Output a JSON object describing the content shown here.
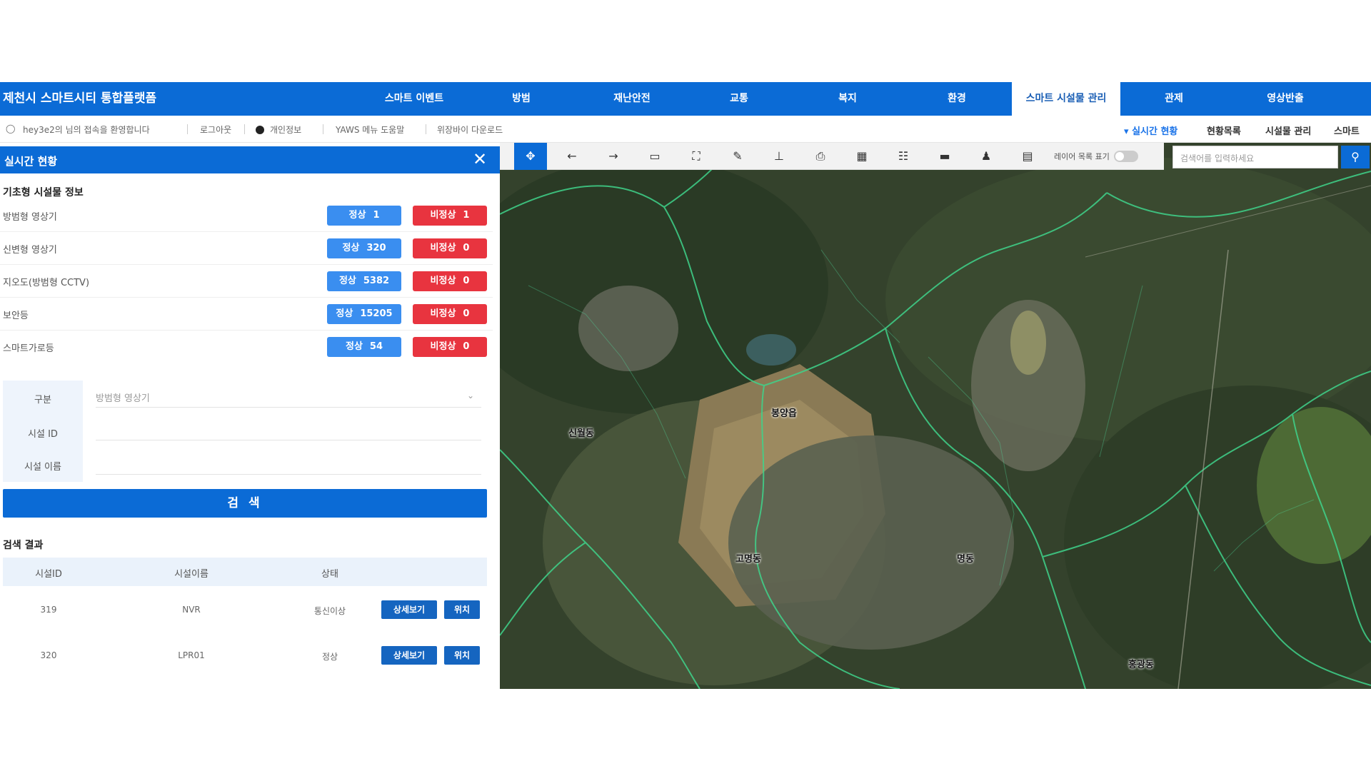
{
  "app": {
    "title": "제천시 스마트시티 통합플랫폼"
  },
  "nav": {
    "items": [
      {
        "label": "스마트 이벤트"
      },
      {
        "label": "방범"
      },
      {
        "label": "재난안전"
      },
      {
        "label": "교통"
      },
      {
        "label": "복지"
      },
      {
        "label": "환경"
      },
      {
        "label": "스마트 시설물 관리"
      },
      {
        "label": "관제"
      },
      {
        "label": "영상반출"
      }
    ],
    "active_index": 6
  },
  "infobar": {
    "greeting": "hey3e2의 님의 접속을 환영합니다",
    "logout": "로그아웃",
    "my_info": "개인정보",
    "yaws": "YAWS 메뉴 도움말",
    "link4": "위장바이 다운로드",
    "right_links": [
      "실시간 현황",
      "현황목록",
      "시설물 관리",
      "스마트"
    ]
  },
  "panel": {
    "title": "실시간 현황",
    "close_icon": "close-icon",
    "section_title": "기초형 시설물 정보",
    "rows": [
      {
        "label": "방범형 영상기",
        "normal_label": "정상",
        "normal_count": "1",
        "abnormal_label": "비정상",
        "abnormal_count": "1"
      },
      {
        "label": "신변형 영상기",
        "normal_label": "정상",
        "normal_count": "320",
        "abnormal_label": "비정상",
        "abnormal_count": "0"
      },
      {
        "label": "지오도(방범형 CCTV)",
        "normal_label": "정상",
        "normal_count": "5382",
        "abnormal_label": "비정상",
        "abnormal_count": "0"
      },
      {
        "label": "보안등",
        "normal_label": "정상",
        "normal_count": "15205",
        "abnormal_label": "비정상",
        "abnormal_count": "0"
      },
      {
        "label": "스마트가로등",
        "normal_label": "정상",
        "normal_count": "54",
        "abnormal_label": "비정상",
        "abnormal_count": "0"
      }
    ],
    "form": {
      "type_label": "구분",
      "type_value": "방범형 영상기",
      "id_label": "시설 ID",
      "name_label": "시설 이름"
    },
    "search_button": "검 색",
    "results_title": "검색 결과",
    "table": {
      "headers": [
        "시설ID",
        "시설이름",
        "상태"
      ],
      "rows": [
        {
          "id": "319",
          "name": "NVR",
          "status": "통신이상",
          "detail": "상세보기",
          "locate": "위치"
        },
        {
          "id": "320",
          "name": "LPR01",
          "status": "정상",
          "detail": "상세보기",
          "locate": "위치"
        }
      ]
    }
  },
  "map": {
    "search_placeholder": "검색어를 입력하세요",
    "toggle_label": "레이어 목록 표기",
    "places": [
      "신월동",
      "봉양읍",
      "고명동",
      "명동",
      "홍광동"
    ],
    "tools": [
      "pan-icon",
      "back-icon",
      "forward-icon",
      "capture-icon",
      "area-select-icon",
      "draw-icon",
      "measure-icon",
      "print-icon",
      "layer-icon",
      "grid-icon",
      "map-icon",
      "user-icon",
      "legend-icon"
    ],
    "tool_glyphs": [
      "✥",
      "←",
      "→",
      "▭",
      "⛶",
      "✎",
      "⊥",
      "⎙",
      "▦",
      "☷",
      "▬",
      "♟",
      "▤"
    ]
  },
  "colors": {
    "primary": "#0b6bd6",
    "normal": "#3a8ef0",
    "abnormal": "#e8343f",
    "border_line": "#3fd38b"
  }
}
